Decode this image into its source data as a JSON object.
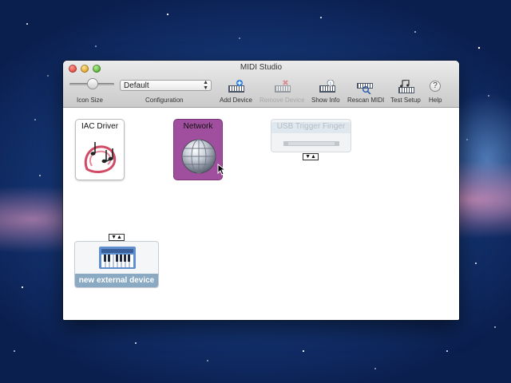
{
  "window": {
    "title": "MIDI Studio"
  },
  "toolbar": {
    "icon_size_label": "Icon Size",
    "configuration": {
      "label": "Configuration",
      "value": "Default"
    },
    "buttons": [
      {
        "label": "Add Device",
        "icon": "add-device-icon",
        "enabled": true
      },
      {
        "label": "Remove Device",
        "icon": "remove-device-icon",
        "enabled": false
      },
      {
        "label": "Show Info",
        "icon": "show-info-icon",
        "enabled": true
      },
      {
        "label": "Rescan MIDI",
        "icon": "rescan-midi-icon",
        "enabled": true
      },
      {
        "label": "Test Setup",
        "icon": "test-setup-icon",
        "enabled": true
      },
      {
        "label": "Help",
        "icon": "help-icon",
        "enabled": true
      }
    ]
  },
  "devices": [
    {
      "name": "IAC Driver",
      "icon": "iac-driver-icon",
      "selected": false,
      "offline": false
    },
    {
      "name": "Network",
      "icon": "network-globe-icon",
      "selected": true,
      "offline": false
    },
    {
      "name": "USB Trigger Finger",
      "icon": "usb-trigger-finger-icon",
      "selected": false,
      "offline": true
    },
    {
      "name": "new external device",
      "icon": "keyboard-icon",
      "selected": false,
      "offline": false
    }
  ],
  "port_arrows": "▼▲",
  "help_glyph": "?",
  "colors": {
    "selected": "#9f4f9d",
    "external_label_bg": "#8aa9c3",
    "disabled_text": "#a9a9a9"
  }
}
